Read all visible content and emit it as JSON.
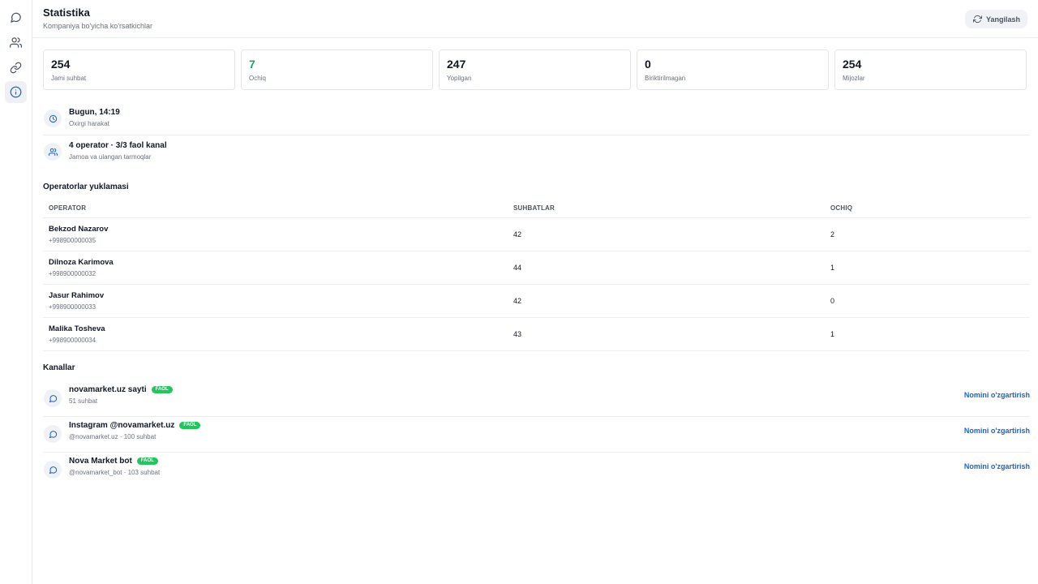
{
  "sidebar": {
    "items": [
      {
        "icon": "chat-bubble-icon",
        "active": false
      },
      {
        "icon": "users-icon",
        "active": false
      },
      {
        "icon": "link-icon",
        "active": false
      },
      {
        "icon": "info-circle-icon",
        "active": true
      }
    ]
  },
  "header": {
    "title": "Statistika",
    "subtitle": "Kompaniya bo'yicha ko'rsatkichlar",
    "refresh_label": "Yangilash"
  },
  "stats": [
    {
      "value": "254",
      "label": "Jami suhbat"
    },
    {
      "value": "7",
      "label": "Ochiq",
      "color": "#22a35a"
    },
    {
      "value": "247",
      "label": "Yopilgan"
    },
    {
      "value": "0",
      "label": "Biriktirilmagan"
    },
    {
      "value": "254",
      "label": "Mijozlar"
    }
  ],
  "activity": {
    "last_action_title": "Bugun, 14:19",
    "last_action_sub": "Oxirgi harakat",
    "team_title": "4 operator · 3/3 faol kanal",
    "team_sub": "Jamoa va ulangan tarmoqlar"
  },
  "operators_section": {
    "title": "Operatorlar yuklamasi",
    "columns": [
      "OPERATOR",
      "SUHBATLAR",
      "OCHIQ"
    ],
    "rows": [
      {
        "name": "Bekzod Nazarov",
        "phone": "+998900000035",
        "chats": "42",
        "open": "2"
      },
      {
        "name": "Dilnoza Karimova",
        "phone": "+998900000032",
        "chats": "44",
        "open": "1"
      },
      {
        "name": "Jasur Rahimov",
        "phone": "+998900000033",
        "chats": "42",
        "open": "0"
      },
      {
        "name": "Malika Tosheva",
        "phone": "+998900000034",
        "chats": "43",
        "open": "1"
      }
    ]
  },
  "channels_section": {
    "title": "Kanallar",
    "rename_label": "Nomini o'zgartirish",
    "items": [
      {
        "name": "novamarket.uz sayti",
        "badge": "FAOL",
        "sub": "51 suhbat"
      },
      {
        "name": "Instagram @novamarket.uz",
        "badge": "FAOL",
        "sub": "@novamarket.uz · 100 suhbat"
      },
      {
        "name": "Nova Market bot",
        "badge": "FAOL",
        "sub": "@novamarket_bot · 103 suhbat"
      }
    ]
  },
  "colors": {
    "accent_link": "#1d64c9",
    "badge_green": "#22c55e",
    "open_green": "#22a35a"
  }
}
